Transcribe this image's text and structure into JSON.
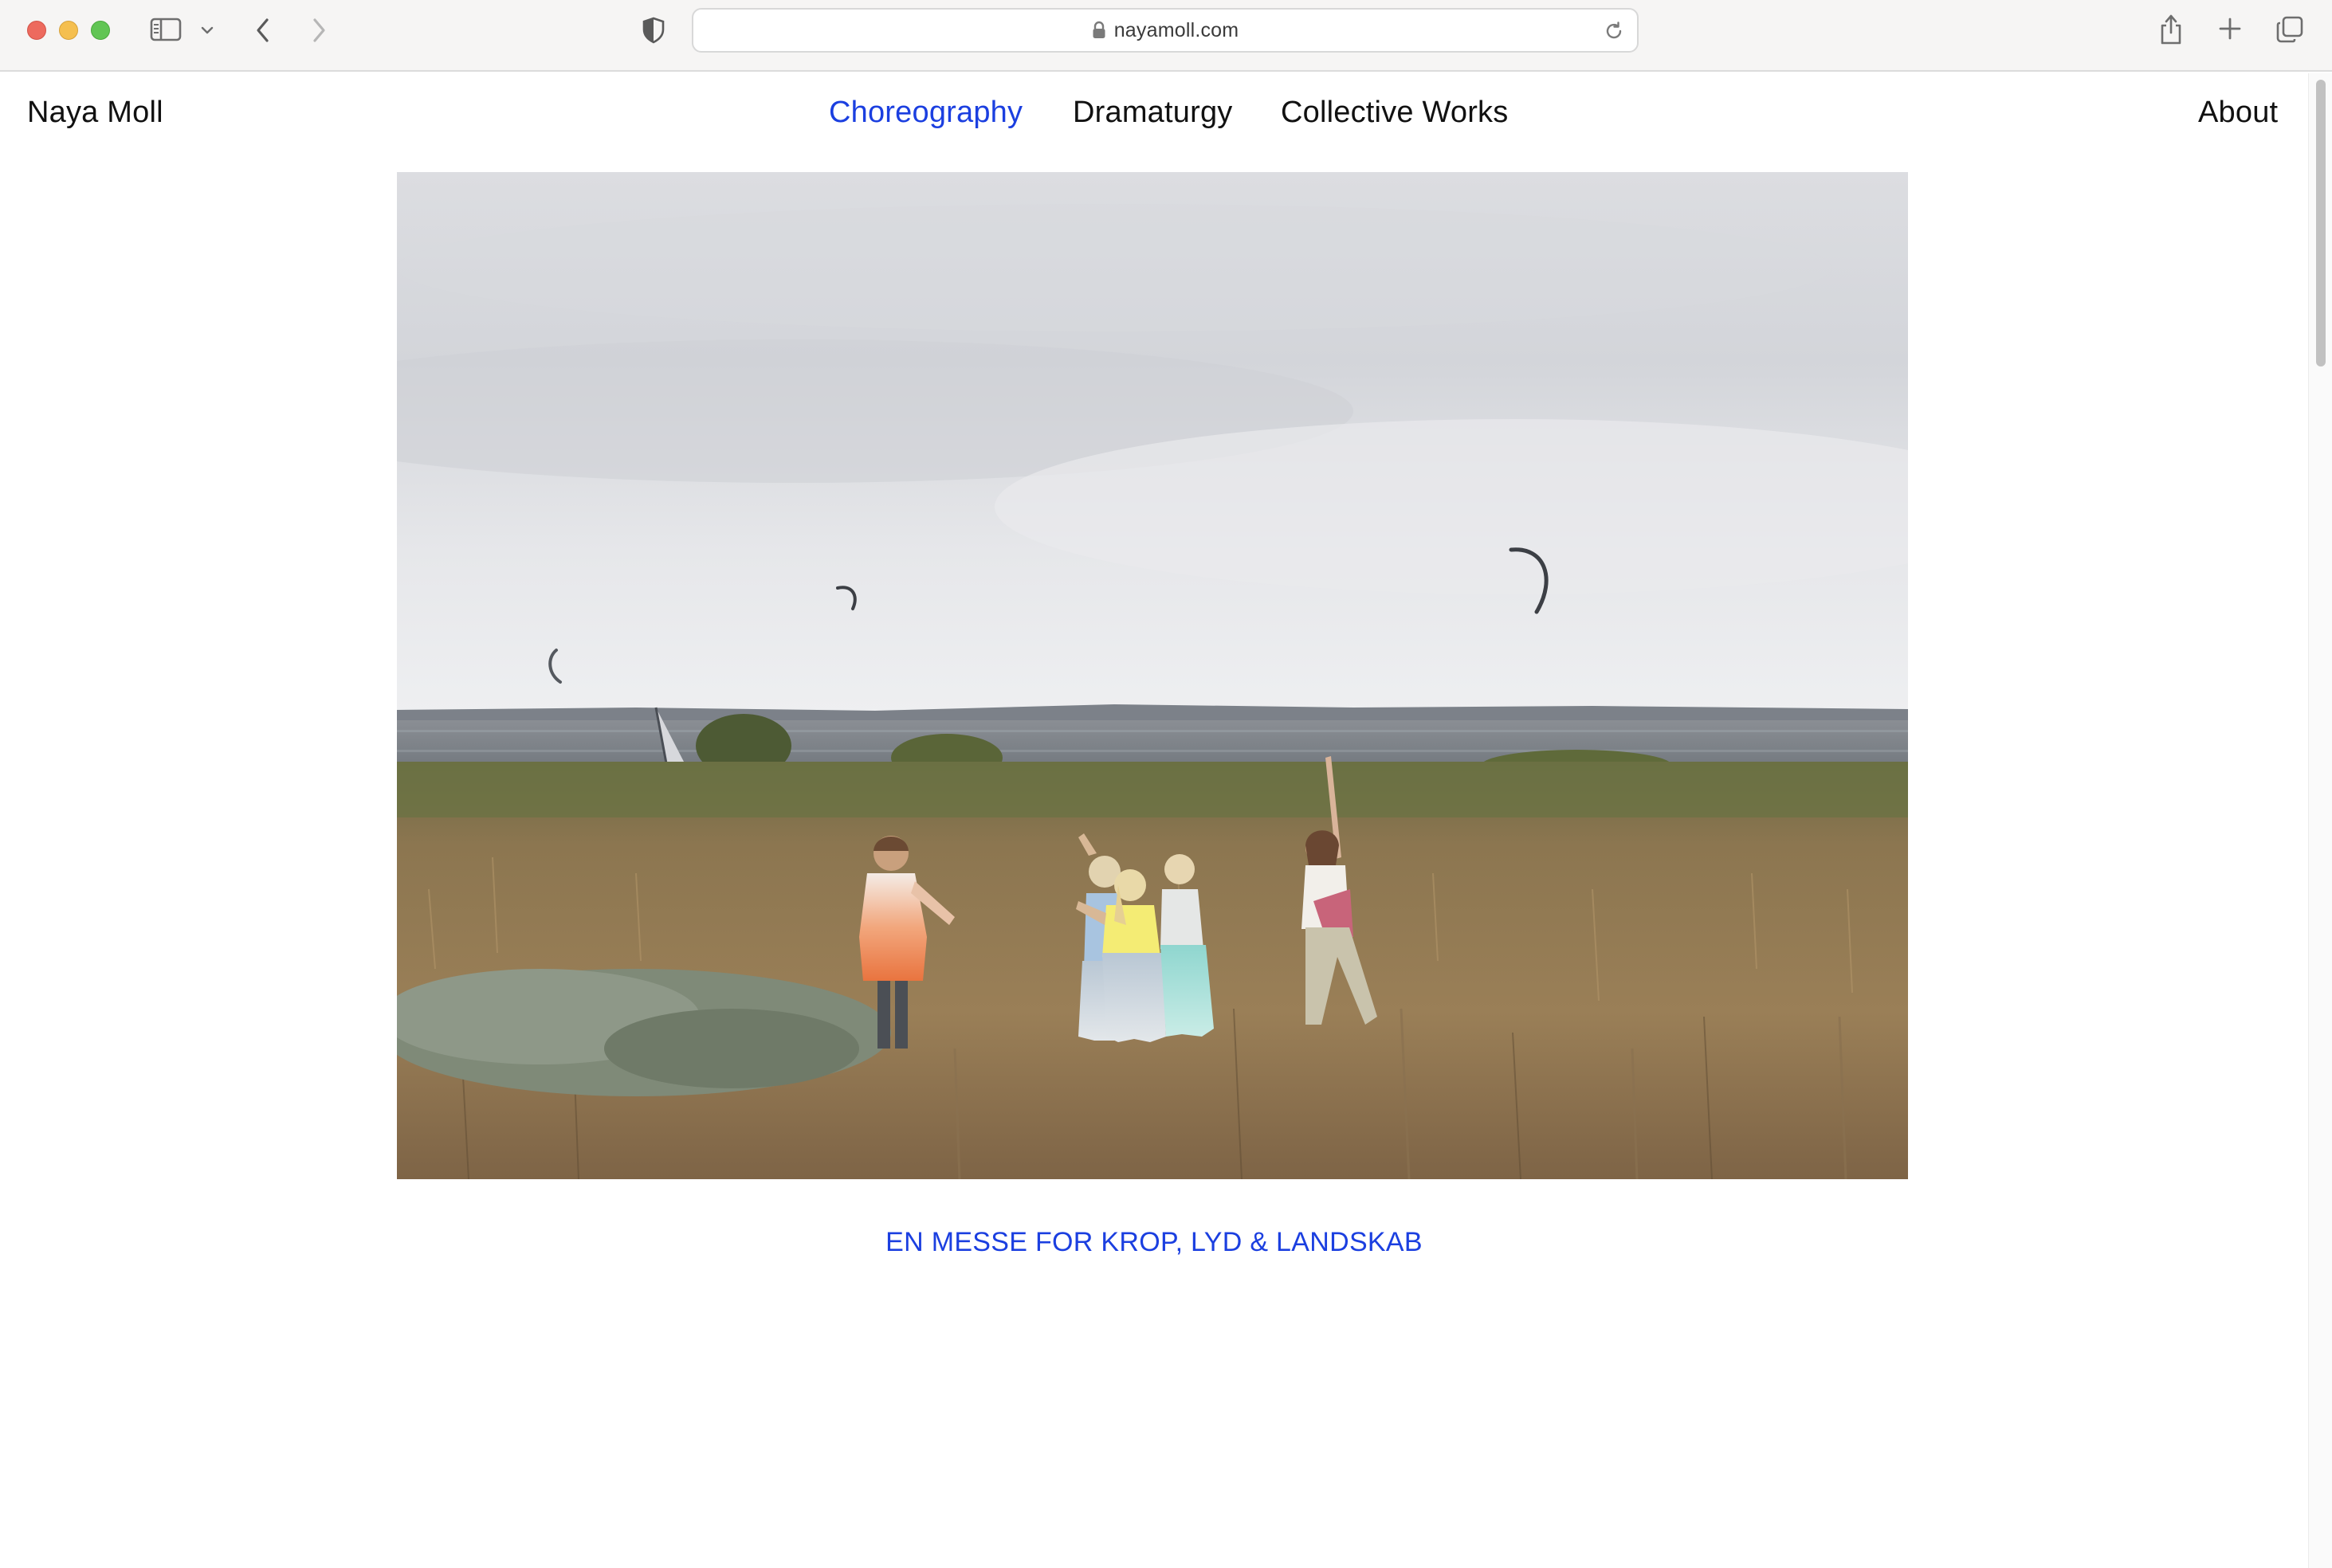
{
  "browser": {
    "url": "nayamoll.com",
    "icons": [
      "sidebar-icon",
      "chevron-down-icon",
      "back-arrow-icon",
      "forward-arrow-icon",
      "privacy-shield-icon",
      "lock-icon",
      "reload-icon",
      "share-icon",
      "plus-icon",
      "tabs-overview-icon"
    ]
  },
  "site": {
    "title": "Naya Moll"
  },
  "nav": {
    "items": [
      {
        "label": "Choreography",
        "active": true
      },
      {
        "label": "Dramaturgy",
        "active": false
      },
      {
        "label": "Collective Works",
        "active": false
      }
    ],
    "about": "About"
  },
  "main": {
    "caption": "EN MESSE FOR KROP, LYD & LANDSKAB"
  },
  "colors": {
    "accent": "#1b3fe0",
    "text": "#111111",
    "background": "#ffffff"
  }
}
